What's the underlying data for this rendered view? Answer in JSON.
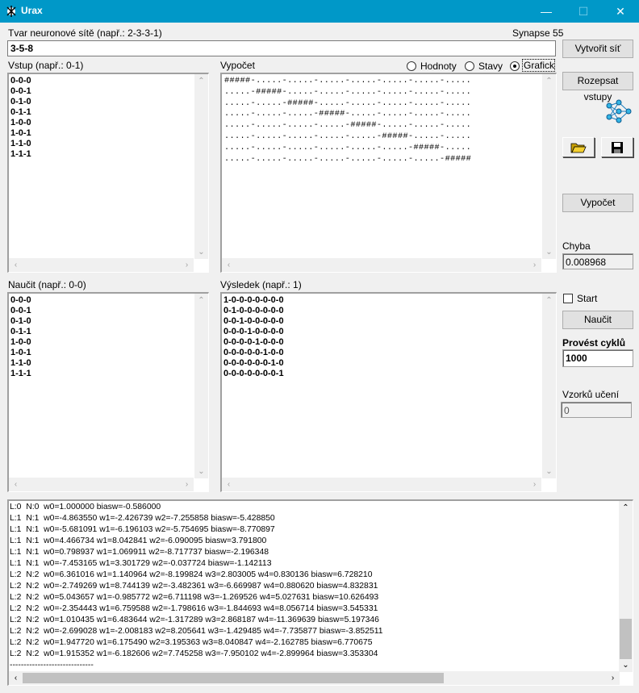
{
  "window": {
    "title": "Urax",
    "minimize": "—",
    "maximize": "☐",
    "close": "✕"
  },
  "shape": {
    "label": "Tvar neuronové sítě (např.: 2-3-3-1)",
    "value": "3-5-8",
    "synapse": "Synapse 55"
  },
  "input": {
    "label": "Vstup (např.: 0-1)",
    "lines": "0-0-0\n0-0-1\n0-1-0\n0-1-1\n1-0-0\n1-0-1\n1-1-0\n1-1-1"
  },
  "calc": {
    "label": "Vypočet",
    "radios": [
      "Hodnoty",
      "Stavy",
      "Graficky"
    ],
    "selected": "Graficky",
    "lines": "#####-.....-.....-.....-.....-.....-.....-.....\n.....-#####-.....-.....-.....-.....-.....-.....\n.....-.....-#####-.....-.....-.....-.....-.....\n.....-.....-.....-#####-.....-.....-.....-.....\n.....-.....-.....-.....-#####-.....-.....-.....\n.....-.....-.....-.....-.....-#####-.....-.....\n.....-.....-.....-.....-.....-.....-#####-.....\n.....-.....-.....-.....-.....-.....-.....-#####"
  },
  "learn": {
    "label": "Naučit (např.: 0-0)",
    "lines": "0-0-0\n0-0-1\n0-1-0\n0-1-1\n1-0-0\n1-0-1\n1-1-0\n1-1-1"
  },
  "result": {
    "label": "Výsledek (např.: 1)",
    "lines": "1-0-0-0-0-0-0-0\n0-1-0-0-0-0-0-0\n0-0-1-0-0-0-0-0\n0-0-0-1-0-0-0-0\n0-0-0-0-1-0-0-0\n0-0-0-0-0-1-0-0\n0-0-0-0-0-0-1-0\n0-0-0-0-0-0-0-1"
  },
  "side": {
    "create_btn": "Vytvořit síť",
    "rewrite_btn": "Rozepsat vstupy",
    "compute_btn": "Vypočet",
    "error_label": "Chyba",
    "error_value": "0.008968",
    "start_label": "Start",
    "learn_btn": "Naučit",
    "cycles_label": "Provést cyklů",
    "cycles_value": "1000",
    "samples_label": "Vzorků učení",
    "samples_value": "0"
  },
  "log": {
    "lines": "L:0  N:0  w0=1.000000 biasw=-0.586000\nL:1  N:1  w0=-4.863550 w1=-2.426739 w2=-7.255858 biasw=-5.428850\nL:1  N:1  w0=-5.681091 w1=-6.196103 w2=-5.754695 biasw=-8.770897\nL:1  N:1  w0=4.466734 w1=8.042841 w2=-6.090095 biasw=3.791800\nL:1  N:1  w0=0.798937 w1=1.069911 w2=-8.717737 biasw=-2.196348\nL:1  N:1  w0=-7.453165 w1=3.301729 w2=-0.037724 biasw=-1.142113\nL:2  N:2  w0=6.361016 w1=1.140964 w2=-8.199824 w3=2.803005 w4=0.830136 biasw=6.728210\nL:2  N:2  w0=-2.749269 w1=8.744139 w2=-3.482361 w3=-6.669987 w4=0.880620 biasw=4.832831\nL:2  N:2  w0=5.043657 w1=-0.985772 w2=6.711198 w3=-1.269526 w4=5.027631 biasw=10.626493\nL:2  N:2  w0=-2.354443 w1=6.759588 w2=-1.798616 w3=-1.844693 w4=8.056714 biasw=3.545331\nL:2  N:2  w0=1.010435 w1=6.483644 w2=-1.317289 w3=2.868187 w4=-11.369639 biasw=5.197346\nL:2  N:2  w0=-2.699028 w1=-2.008183 w2=8.205641 w3=-1.429485 w4=-7.735877 biasw=-3.852511\nL:2  N:2  w0=1.947720 w1=6.175490 w2=3.195363 w3=8.040847 w4=-2.162785 biasw=6.770675\nL:2  N:2  w0=1.915352 w1=-6.182606 w2=7.745258 w3=-7.950102 w4=-2.899964 biasw=3.353304\n------------------------------"
  }
}
